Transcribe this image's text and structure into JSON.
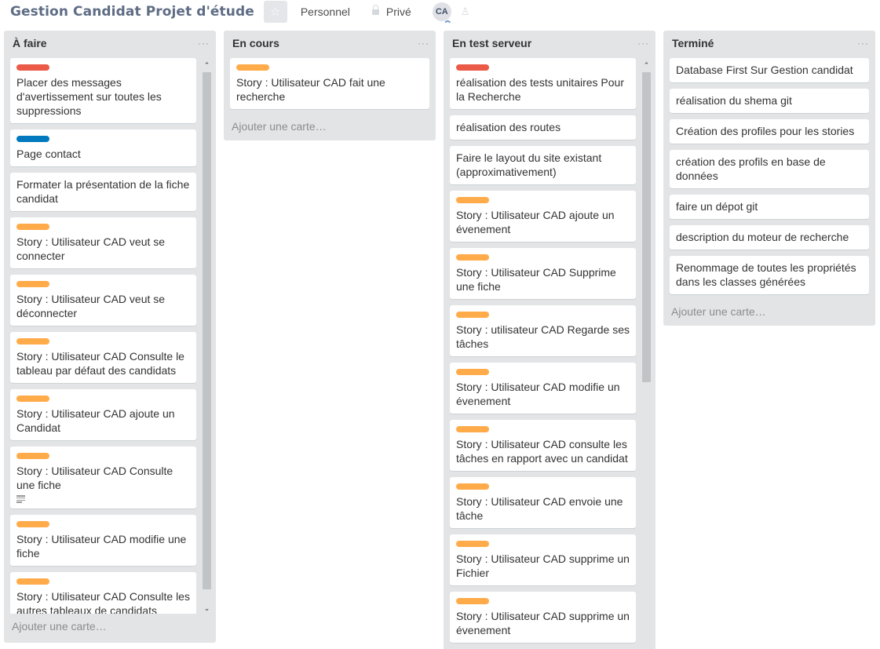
{
  "header": {
    "title": "Gestion Candidat Projet d'étude",
    "visibility_team": "Personnel",
    "visibility_privacy": "Privé",
    "avatar_initials": "CA"
  },
  "colors": {
    "red": "#eb5a46",
    "blue": "#0079bf",
    "orange": "#ffab4a"
  },
  "lists": [
    {
      "title": "À faire",
      "menu": "···",
      "add_card": "Ajouter une carte…",
      "cards": [
        {
          "label": "red",
          "text": "Placer des messages d'avertissement sur toutes les suppressions"
        },
        {
          "label": "blue",
          "text": "Page contact"
        },
        {
          "label": null,
          "text": "Formater la présentation de la fiche candidat"
        },
        {
          "label": "orange",
          "text": "Story : Utilisateur CAD veut se connecter"
        },
        {
          "label": "orange",
          "text": "Story : Utilisateur CAD veut se déconnecter"
        },
        {
          "label": "orange",
          "text": "Story : Utilisateur CAD Consulte le tableau par défaut des candidats"
        },
        {
          "label": "orange",
          "text": "Story : Utilisateur CAD ajoute un Candidat"
        },
        {
          "label": "orange",
          "text": "Story : Utilisateur CAD Consulte une fiche",
          "has_description": true
        },
        {
          "label": "orange",
          "text": "Story : Utilisateur CAD modifie une fiche"
        },
        {
          "label": "orange",
          "text": "Story : Utilisateur CAD Consulte les autres tableaux de candidats"
        }
      ]
    },
    {
      "title": "En cours",
      "menu": "···",
      "add_card": "Ajouter une carte…",
      "cards": [
        {
          "label": "orange",
          "text": "Story : Utilisateur CAD fait une recherche"
        }
      ]
    },
    {
      "title": "En test serveur",
      "menu": "···",
      "add_card": "",
      "cards": [
        {
          "label": "red",
          "text": "réalisation des tests unitaires Pour la Recherche"
        },
        {
          "label": null,
          "text": "réalisation des routes"
        },
        {
          "label": null,
          "text": "Faire le layout du site existant (approximativement)"
        },
        {
          "label": "orange",
          "text": "Story : Utilisateur CAD ajoute un évenement"
        },
        {
          "label": "orange",
          "text": "Story : Utilisateur CAD Supprime une fiche"
        },
        {
          "label": "orange",
          "text": "Story : utilisateur CAD Regarde ses tâches"
        },
        {
          "label": "orange",
          "text": "Story : Utilisateur CAD modifie un évenement"
        },
        {
          "label": "orange",
          "text": "Story : Utilisateur CAD consulte les tâches en rapport avec un candidat"
        },
        {
          "label": "orange",
          "text": "Story : Utilisateur CAD envoie une tâche"
        },
        {
          "label": "orange",
          "text": "Story : Utilisateur CAD supprime un Fichier"
        },
        {
          "label": "orange",
          "text": "Story : Utilisateur CAD supprime un évenement"
        },
        {
          "label": "orange",
          "text": ""
        }
      ]
    },
    {
      "title": "Terminé",
      "menu": "···",
      "add_card": "Ajouter une carte…",
      "cards": [
        {
          "label": null,
          "text": "Database First Sur Gestion candidat"
        },
        {
          "label": null,
          "text": "réalisation du shema git"
        },
        {
          "label": null,
          "text": "Création des profiles pour les stories"
        },
        {
          "label": null,
          "text": "création des profils en base de données"
        },
        {
          "label": null,
          "text": "faire un dépot git"
        },
        {
          "label": null,
          "text": "description du moteur de recherche"
        },
        {
          "label": null,
          "text": "Renommage de toutes les propriétés dans les classes générées"
        }
      ]
    }
  ],
  "icons": [
    "star-icon",
    "lock-icon",
    "add-member-icon",
    "list-menu-icon",
    "description-icon",
    "scroll-up-icon",
    "scroll-down-icon"
  ]
}
